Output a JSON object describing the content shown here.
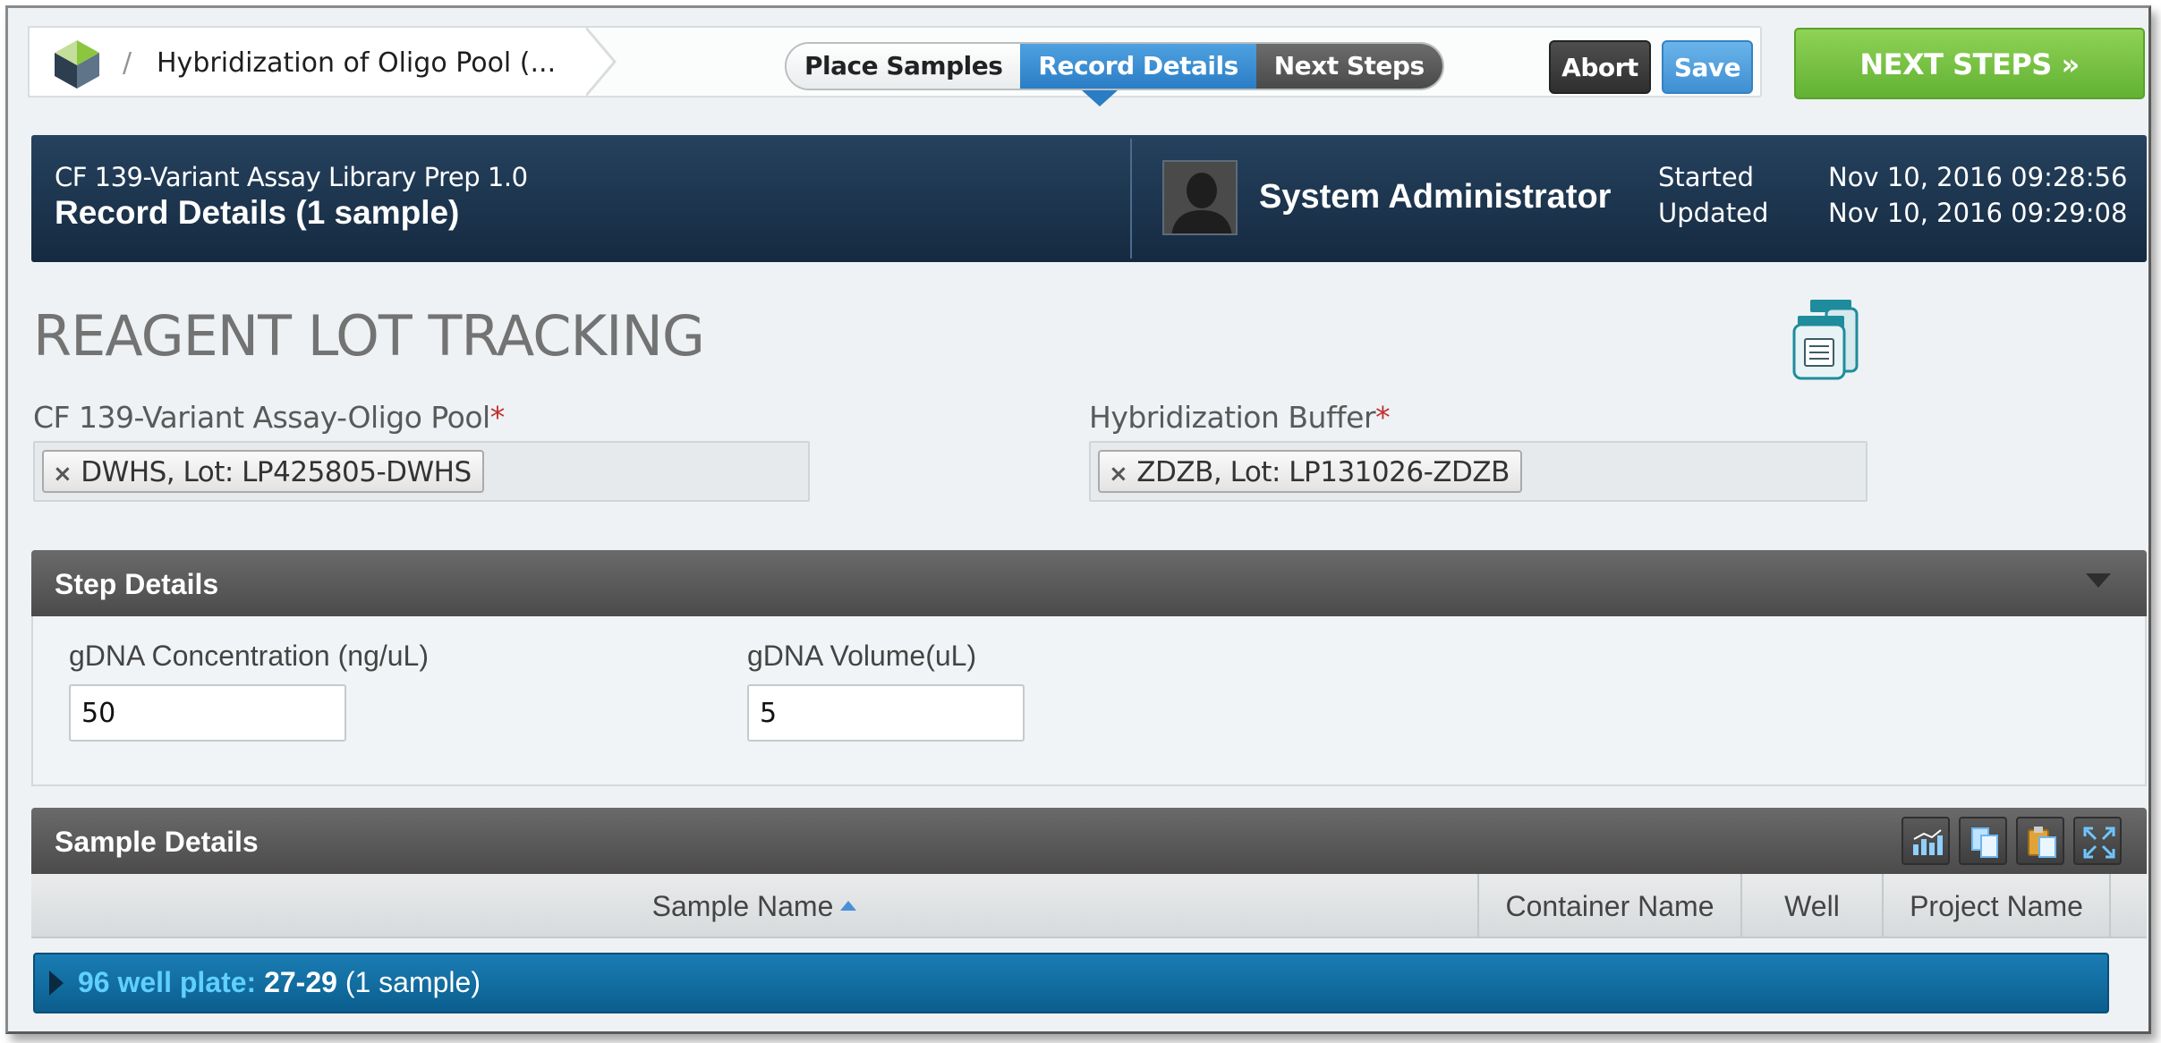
{
  "breadcrumb": {
    "separator": "/",
    "step_title": "Hybridization of Oligo Pool (..."
  },
  "steps_nav": {
    "items": [
      "Place Samples",
      "Record Details",
      "Next Steps"
    ],
    "active": "Record Details"
  },
  "actions": {
    "abort_label": "Abort",
    "save_label": "Save",
    "next_label": "NEXT STEPS »"
  },
  "header": {
    "protocol": "CF 139-Variant Assay Library Prep 1.0",
    "title": "Record Details (1 sample)",
    "user": "System Administrator",
    "started_label": "Started",
    "started_value": "Nov 10, 2016 09:28:56",
    "updated_label": "Updated",
    "updated_value": "Nov 10, 2016 09:29:08"
  },
  "reagents": {
    "heading": "REAGENT LOT TRACKING",
    "required_marker": "*",
    "oligo_label": "CF 139-Variant Assay-Oligo Pool",
    "oligo_lot": "DWHS, Lot: LP425805-DWHS",
    "buffer_label": "Hybridization Buffer",
    "buffer_lot": "ZDZB, Lot: LP131026-ZDZB",
    "remove_glyph": "×"
  },
  "step_details": {
    "title": "Step Details",
    "conc_label": "gDNA Concentration (ng/uL)",
    "conc_value": "50",
    "vol_label": "gDNA Volume(uL)",
    "vol_value": "5"
  },
  "sample_details": {
    "title": "Sample Details",
    "columns": [
      "Sample Name",
      "Container Name",
      "Well",
      "Project Name"
    ],
    "sorted_column": "Sample Name",
    "group": {
      "prefix": "96 well plate:",
      "name": "27-29",
      "count": "(1 sample)"
    }
  },
  "colors": {
    "accent_blue": "#2a7dc5",
    "next_green": "#62b233",
    "header_navy": "#152a40",
    "group_blue": "#0b5e8e"
  }
}
